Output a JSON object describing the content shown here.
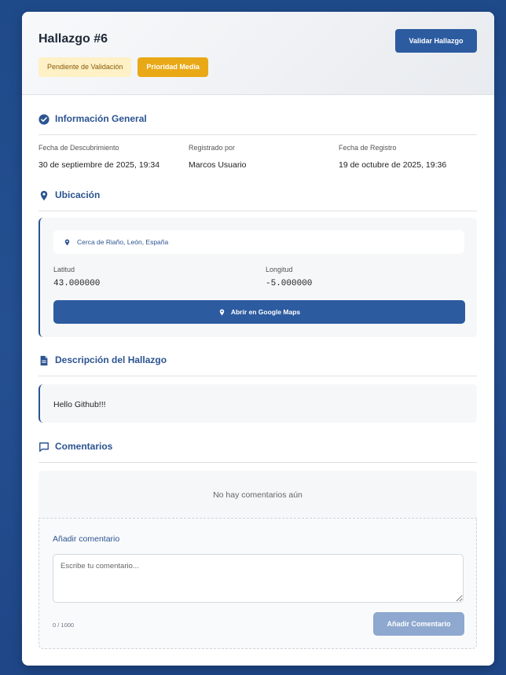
{
  "header": {
    "title": "Hallazgo #6",
    "status_badge": "Pendiente de Validación",
    "priority_badge": "Prioridad Media",
    "validate_label": "Validar Hallazgo"
  },
  "general": {
    "title": "Información General",
    "fields": [
      {
        "label": "Fecha de Descubrimiento",
        "value": "30 de septiembre de 2025, 19:34"
      },
      {
        "label": "Registrado por",
        "value": "Marcos Usuario"
      },
      {
        "label": "Fecha de Registro",
        "value": "19 de octubre de 2025, 19:36"
      }
    ]
  },
  "location": {
    "title": "Ubicación",
    "address": "Cerca de Riaño, León, España",
    "lat_label": "Latitud",
    "lat_value": "43.000000",
    "lng_label": "Longitud",
    "lng_value": "-5.000000",
    "maps_button": "Abrir en Google Maps"
  },
  "description": {
    "title": "Descripción del Hallazgo",
    "text": "Hello Github!!!"
  },
  "comments": {
    "title": "Comentarios",
    "empty_text": "No hay comentarios aún",
    "add_title": "Añadir comentario",
    "placeholder": "Escribe tu comentario...",
    "counter": "0 / 1000",
    "add_button": "Añadir Comentario"
  },
  "colors": {
    "background": "#1f4a8a",
    "accent": "#2c5491",
    "primary_button": "#2c5ba0",
    "pending_badge_bg": "#fdf1c5",
    "priority_badge_bg": "#e9a815",
    "disabled_button": "#8ea8cf"
  },
  "icons": {
    "general": "check-circle-icon",
    "location": "map-pin-icon",
    "description": "document-icon",
    "comments": "comment-icon"
  }
}
